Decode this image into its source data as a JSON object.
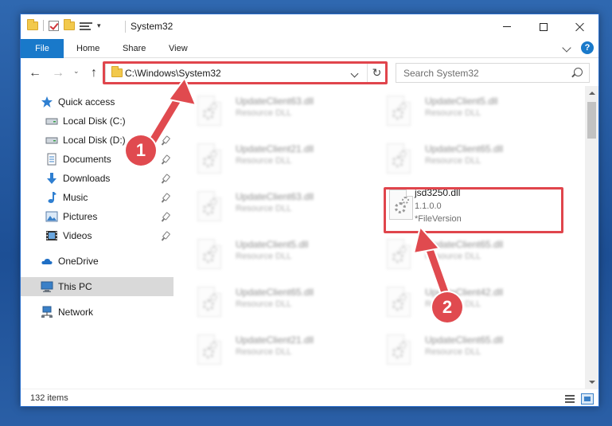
{
  "window": {
    "title": "System32",
    "controls": {
      "minimize": "minimize",
      "maximize": "maximize",
      "close": "close"
    }
  },
  "ribbon": {
    "tabs": [
      {
        "label": "File"
      },
      {
        "label": "Home"
      },
      {
        "label": "Share"
      },
      {
        "label": "View"
      }
    ],
    "help": "?"
  },
  "nav": {
    "back": "←",
    "forward": "→",
    "recent": "⌄",
    "up": "↑",
    "address": "C:\\Windows\\System32",
    "refresh": "↻",
    "search_placeholder": "Search System32"
  },
  "sidebar": {
    "items": [
      {
        "label": "Quick access",
        "icon": "star-icon",
        "pinned": false
      },
      {
        "label": "Local Disk (C:)",
        "icon": "drive-icon",
        "pinned": true
      },
      {
        "label": "Local Disk (D:)",
        "icon": "drive-icon",
        "pinned": true
      },
      {
        "label": "Documents",
        "icon": "documents-icon",
        "pinned": true
      },
      {
        "label": "Downloads",
        "icon": "download-icon",
        "pinned": true
      },
      {
        "label": "Music",
        "icon": "music-icon",
        "pinned": true
      },
      {
        "label": "Pictures",
        "icon": "pictures-icon",
        "pinned": true
      },
      {
        "label": "Videos",
        "icon": "videos-icon",
        "pinned": true
      },
      {
        "label": "OneDrive",
        "icon": "cloud-icon",
        "pinned": false
      },
      {
        "label": "This PC",
        "icon": "computer-icon",
        "pinned": false,
        "selected": true
      },
      {
        "label": "Network",
        "icon": "network-icon",
        "pinned": false
      }
    ]
  },
  "files": [
    {
      "name": "UpdateClient63.dll",
      "desc": "Resource DLL"
    },
    {
      "name": "UpdateClient5.dll",
      "desc": "Resource DLL"
    },
    {
      "name": "UpdateClient21.dll",
      "desc": "Resource DLL"
    },
    {
      "name": "UpdateClient65.dll",
      "desc": "Resource DLL"
    },
    {
      "name": "UpdateClient63.dll",
      "desc": "Resource DLL"
    },
    {
      "name": "jsd3250.dll",
      "version": "1.1.0.0",
      "desc": "*FileVersion",
      "highlighted": true
    },
    {
      "name": "UpdateClient5.dll",
      "desc": "Resource DLL"
    },
    {
      "name": "UpdateClient65.dll",
      "desc": "Resource DLL"
    },
    {
      "name": "UpdateClient65.dll",
      "desc": "Resource DLL"
    },
    {
      "name": "UpdateClient42.dll",
      "desc": "Resource DLL"
    },
    {
      "name": "UpdateClient21.dll",
      "desc": "Resource DLL"
    },
    {
      "name": "UpdateClient65.dll",
      "desc": "Resource DLL"
    }
  ],
  "status": {
    "count": "132 items"
  },
  "annotations": [
    {
      "number": "1",
      "color": "#e04a4f"
    },
    {
      "number": "2",
      "color": "#e04a4f"
    }
  ],
  "colors": {
    "accent": "#1979ca",
    "highlight": "#e0454c"
  }
}
